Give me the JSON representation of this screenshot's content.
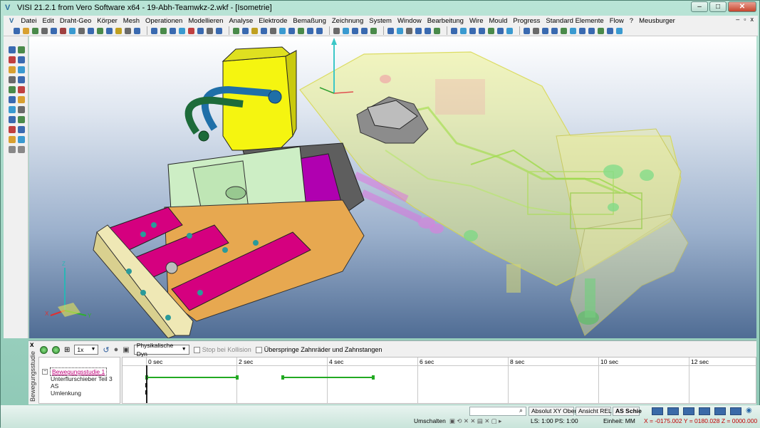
{
  "window": {
    "title": "VISI 21.2.1 from Vero Software x64 - 19-Abh-Teamwkz-2.wkf - [Isometrie]",
    "minimize": "–",
    "maximize": "□",
    "close": "✕"
  },
  "menu": {
    "items": [
      "Datei",
      "Edit",
      "Draht-Geo",
      "Körper",
      "Mesh",
      "Operationen",
      "Modellieren",
      "Analyse",
      "Elektrode",
      "Bemaßung",
      "Zeichnung",
      "System",
      "Window",
      "Bearbeitung",
      "Wire",
      "Mould",
      "Progress",
      "Standard Elemente",
      "Flow",
      "?",
      "Meusburger"
    ],
    "mdi_min": "–",
    "mdi_restore": "▫",
    "mdi_close": "x"
  },
  "motion": {
    "close": "x",
    "side_label": "Bewegungsstudie",
    "speed": "1x",
    "physics_mode": "Physikalische Dyn",
    "stop_collision": "Stop bei Kollision",
    "skip_gears": "Überspringe Zahnräder und Zahnstangen",
    "tree": {
      "root": "Bewegungsstudie 1",
      "children": [
        "Unterflurschieber Teil 3",
        "AS",
        "Umlenkung"
      ]
    },
    "ticks": [
      "0 sec",
      "2 sec",
      "4 sec",
      "6 sec",
      "8 sec",
      "10 sec",
      "12 sec"
    ]
  },
  "status": {
    "search_value": "",
    "absolut": "Absolut XY Ober",
    "ansicht": "Ansicht REL",
    "as_schie": "AS Schie",
    "umschalten": "Umschalten",
    "ls_ps": "LS: 1:00 PS: 1:00",
    "einheit": "Einheit: MM",
    "coords": "X = -0175.002 Y = 0180.028 Z = 0000.000"
  },
  "colors": {
    "window_frame": "#8ec8b5",
    "accent_magenta": "#d5007f",
    "timeline_bar": "#22aa22",
    "coords_red": "#c00000"
  }
}
